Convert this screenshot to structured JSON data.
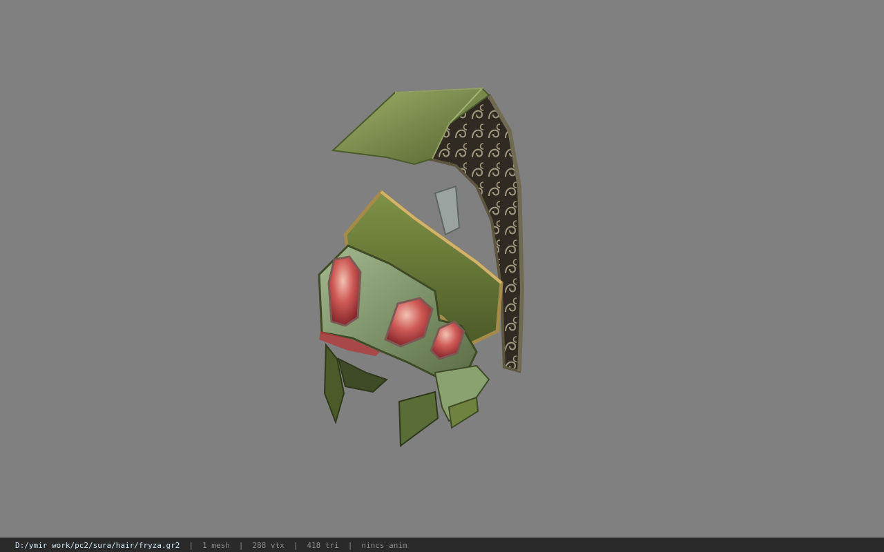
{
  "viewport": {
    "background_color": "#808080",
    "model_colors": {
      "armor_green": "#6f8240",
      "armor_dark": "#3f4a26",
      "armor_light": "#9fb06a",
      "gold_trim": "#a68a4a",
      "ornament_dark": "#2f2a22",
      "ornament_light": "#a29a82",
      "gem_red": "#b23a3a",
      "gem_highlight": "#f2c2b2"
    }
  },
  "statusbar": {
    "file_path": "D:/ymir work/pc2/sura/hair/fryza.gr2",
    "separator": "|",
    "mesh_count": "1 mesh",
    "vertex_count": "288 vtx",
    "triangle_count": "418 tri",
    "anim_status": "nincs anim"
  }
}
